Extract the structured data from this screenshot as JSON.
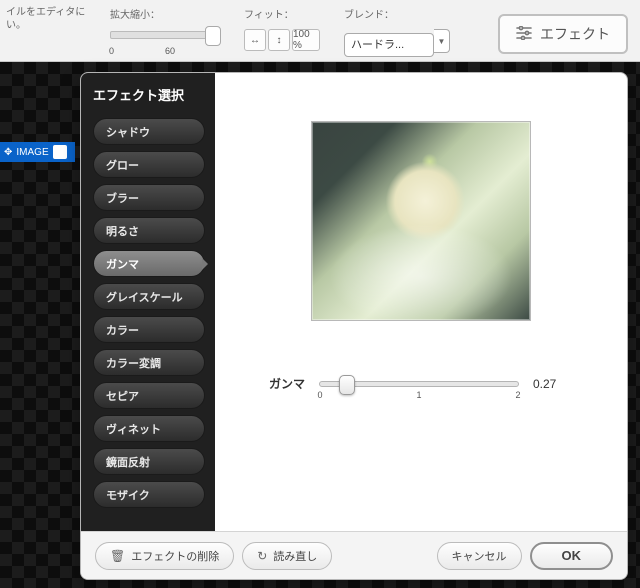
{
  "toolbar": {
    "intro_text": "イルをエディタに\nい。",
    "zoom_label": "拡大縮小：",
    "zoom_min": "0",
    "zoom_value": "60",
    "fit_label": "フィット：",
    "fit_pct": "100\n%",
    "blend_label": "ブレンド：",
    "blend_value": "ハードラ...",
    "effect_button": "エフェクト"
  },
  "image_tag": "IMAGE",
  "dialog": {
    "title": "エフェクト選択",
    "effects": [
      "シャドウ",
      "グロー",
      "ブラー",
      "明るさ",
      "ガンマ",
      "グレイスケール",
      "カラー",
      "カラー変調",
      "セピア",
      "ヴィネット",
      "鏡面反射",
      "モザイク"
    ],
    "selected_index": 4,
    "control": {
      "label": "ガンマ",
      "min": "0",
      "mid": "1",
      "max": "2",
      "value": "0.27",
      "value_num": 0.27,
      "range_max": 2
    },
    "footer": {
      "delete": "エフェクトの削除",
      "reload": "読み直し",
      "cancel": "キャンセル",
      "ok": "OK"
    }
  }
}
